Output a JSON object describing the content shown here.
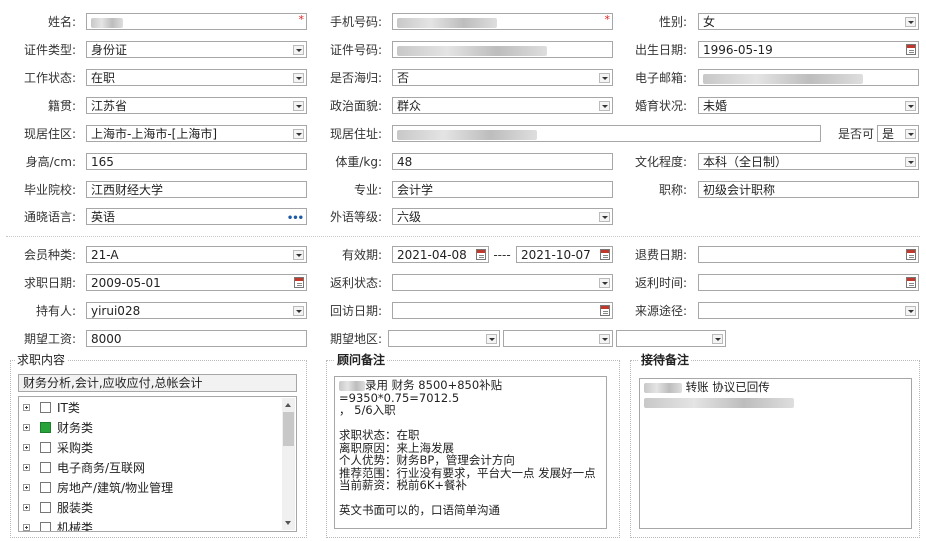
{
  "labels": {
    "name": "姓名:",
    "phone": "手机号码:",
    "gender": "性别:",
    "id_type": "证件类型:",
    "id_number": "证件号码:",
    "birth": "出生日期:",
    "work_status": "工作状态:",
    "returnee": "是否海归:",
    "email": "电子邮箱:",
    "native": "籍贯:",
    "politics": "政治面貌:",
    "marital": "婚育状况:",
    "residence": "现居住区:",
    "address": "现居住址:",
    "can_or_not": "是否可",
    "height": "身高/cm:",
    "weight": "体重/kg:",
    "education": "文化程度:",
    "school": "毕业院校:",
    "major": "专业:",
    "title": "职称:",
    "language": "通晓语言:",
    "lang_level": "外语等级:",
    "member_type": "会员种类:",
    "validity": "有效期:",
    "refund_date": "退费日期:",
    "job_date": "求职日期:",
    "rebate_status": "返利状态:",
    "rebate_time": "返利时间:",
    "holder": "持有人:",
    "revisit": "回访日期:",
    "source": "来源途径:",
    "salary": "期望工资:",
    "region": "期望地区:"
  },
  "values": {
    "gender": "女",
    "id_type": "身份证",
    "birth": "1996-05-19",
    "work_status": "在职",
    "returnee": "否",
    "native": "江苏省",
    "politics": "群众",
    "marital": "未婚",
    "residence": "上海市-上海市-[上海市]",
    "can_or_not": "是",
    "height": "165",
    "weight": "48",
    "education": "本科（全日制）",
    "school": "江西财经大学",
    "major": "会计学",
    "title": "初级会计职称",
    "language": "英语",
    "lang_level": "六级",
    "member_type": "21-A",
    "validity_from": "2021-04-08",
    "validity_sep": "----",
    "validity_to": "2021-10-07",
    "job_date": "2009-05-01",
    "holder": "yirui028",
    "salary": "8000"
  },
  "job_content": {
    "title": "求职内容",
    "summary": "财务分析,会计,应收应付,总帐会计",
    "categories": [
      {
        "label": "IT类",
        "checked": false
      },
      {
        "label": "财务类",
        "checked": true
      },
      {
        "label": "采购类",
        "checked": false
      },
      {
        "label": "电子商务/互联网",
        "checked": false
      },
      {
        "label": "房地产/建筑/物业管理",
        "checked": false
      },
      {
        "label": "服装类",
        "checked": false
      },
      {
        "label": "机械类",
        "checked": false
      }
    ]
  },
  "consultant_note": {
    "title": "顾问备注",
    "line1": "录用 财务  8500+850补贴=9350*0.75=7012.5",
    "line2": "， 5/6入职",
    "line3": "求职状态：在职",
    "line4": "离职原因：来上海发展",
    "line5": "个人优势：财务BP，管理会计方向",
    "line6": "推荐范围：行业没有要求，平台大一点 发展好一点",
    "line7": "当前薪资：税前6K+餐补",
    "line8": "英文书面可以的，口语简单沟通"
  },
  "reception_note": {
    "title": "接待备注",
    "line1": "转账  协议已回传"
  },
  "colors": {
    "required_star": "#e02020",
    "checked": "#27a33a",
    "calendar_red": "#c0392b"
  }
}
